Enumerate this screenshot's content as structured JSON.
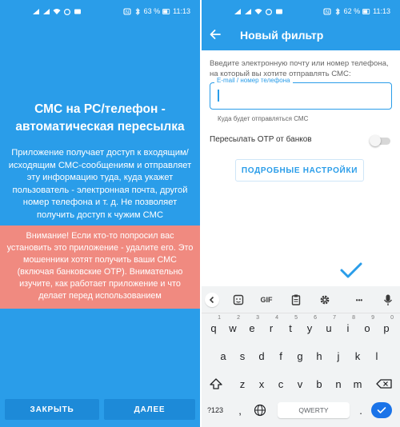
{
  "status_left": {
    "battery": "63 %",
    "time": "11:13"
  },
  "status_right": {
    "battery": "62 %",
    "time": "11:13"
  },
  "intro": {
    "title_line1": "СМС на PC/телефон -",
    "title_line2": "автоматическая пересылка",
    "description": "Приложение получает доступ к входящим/исходящим СМС-сообщениям и отправляет эту информацию туда, куда укажет пользователь - электронная почта, другой номер телефона и т. д. Не позволяет получить доступ к чужим СМС",
    "warning": "Внимание! Если кто-то попросил вас установить это приложение - удалите его. Это мошенники хотят получить ваши СМС (включая банковские OTP). Внимательно изучите, как работает приложение и что делает перед использованием",
    "close_label": "ЗАКРЫТЬ",
    "next_label": "ДАЛЕЕ"
  },
  "filter": {
    "title": "Новый фильтр",
    "instruction": "Введите электронную почту или номер телефона, на который вы хотите отправлять СМС:",
    "field_label": "E-mail / номер телефона",
    "field_value": "",
    "helper": "Куда будет отправляться СМС",
    "otp_label": "Пересылать OTP от банков",
    "otp_enabled": false,
    "advanced_label": "ПОДРОБНЫЕ НАСТРОЙКИ"
  },
  "keyboard": {
    "toolbar": [
      "back",
      "sticker",
      "GIF",
      "clipboard",
      "settings",
      "more",
      "microphone"
    ],
    "gif_label": "GIF",
    "more_label": "•••",
    "row1": [
      "q",
      "w",
      "e",
      "r",
      "t",
      "y",
      "u",
      "i",
      "o",
      "p"
    ],
    "row1_nums": [
      "1",
      "2",
      "3",
      "4",
      "5",
      "6",
      "7",
      "8",
      "9",
      "0"
    ],
    "row2": [
      "a",
      "s",
      "d",
      "f",
      "g",
      "h",
      "j",
      "k",
      "l"
    ],
    "row3": [
      "z",
      "x",
      "c",
      "v",
      "b",
      "n",
      "m"
    ],
    "symbols_key": "?123",
    "comma_key": ",",
    "period_key": ".",
    "space_label": "QWERTY"
  },
  "colors": {
    "accent": "#2a9de9",
    "warning_bg": "#f08a80",
    "button_bg": "#1d8ad8",
    "enter_key": "#1a73e8"
  },
  "icons": [
    "signal-icon",
    "wifi-icon",
    "alarm-icon",
    "nfc-icon",
    "battery-icon",
    "back-arrow-icon",
    "check-icon",
    "microphone-icon",
    "gear-icon",
    "globe-icon",
    "backspace-icon",
    "shift-icon"
  ]
}
